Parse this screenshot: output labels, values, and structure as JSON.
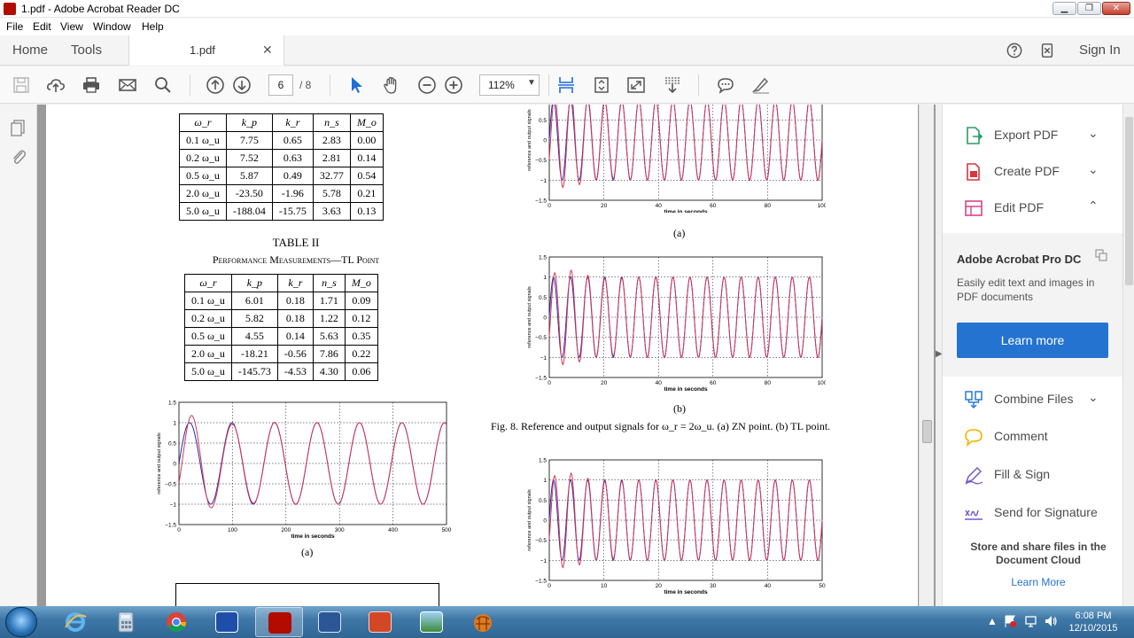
{
  "window": {
    "title": "1.pdf - Adobe Acrobat Reader DC",
    "minimize": "▁",
    "maximize": "❐",
    "close": "✕"
  },
  "menu": [
    "File",
    "Edit",
    "View",
    "Window",
    "Help"
  ],
  "tabs": {
    "home": "Home",
    "tools": "Tools",
    "document": "1.pdf",
    "close_glyph": "✕",
    "sign_in": "Sign In"
  },
  "toolbar": {
    "page_current": "6",
    "page_total": "/ 8",
    "zoom": "112%",
    "zoom_caret": "▼"
  },
  "document": {
    "table1": {
      "headers": [
        "ω_r",
        "k_p",
        "k_r",
        "n_s",
        "M_o"
      ],
      "rows": [
        [
          "0.1 ω_u",
          "7.75",
          "0.65",
          "2.83",
          "0.00"
        ],
        [
          "0.2 ω_u",
          "7.52",
          "0.63",
          "2.81",
          "0.14"
        ],
        [
          "0.5 ω_u",
          "5.87",
          "0.49",
          "32.77",
          "0.54"
        ],
        [
          "2.0 ω_u",
          "-23.50",
          "-1.96",
          "5.78",
          "0.21"
        ],
        [
          "5.0 ω_u",
          "-188.04",
          "-15.75",
          "3.63",
          "0.13"
        ]
      ]
    },
    "table2_title": "TABLE II",
    "table2_subtitle": "Performance Measurements—TL Point",
    "table2": {
      "headers": [
        "ω_r",
        "k_p",
        "k_r",
        "n_s",
        "M_o"
      ],
      "rows": [
        [
          "0.1 ω_u",
          "6.01",
          "0.18",
          "1.71",
          "0.09"
        ],
        [
          "0.2 ω_u",
          "5.82",
          "0.18",
          "1.22",
          "0.12"
        ],
        [
          "0.5 ω_u",
          "4.55",
          "0.14",
          "5.63",
          "0.35"
        ],
        [
          "2.0 ω_u",
          "-18.21",
          "-0.56",
          "7.86",
          "0.22"
        ],
        [
          "5.0 ω_u",
          "-145.73",
          "-4.53",
          "4.30",
          "0.06"
        ]
      ]
    },
    "fig8_caption": "Fig. 8.    Reference and output signals for ω_r = 2ω_u. (a) ZN point. (b) TL point.",
    "plot_ylabel": "reference and output signals",
    "plot_xlabel": "time in seconds",
    "yticks": [
      "1.5",
      "1",
      "0.5",
      "0",
      "−0.5",
      "−1",
      "−1.5"
    ]
  },
  "chart_data": [
    {
      "type": "line",
      "panel": "(a)",
      "xlabel": "time in seconds",
      "ylabel": "reference and output signals",
      "xlim": [
        0,
        100
      ],
      "ylim": [
        -1.5,
        1.5
      ],
      "xticks": [
        "0",
        "20",
        "40",
        "60",
        "80",
        "100"
      ],
      "series": [
        {
          "color": "#2a2aa6",
          "cycles": 16
        },
        {
          "color": "#d23a5a",
          "cycles": 16
        }
      ]
    },
    {
      "type": "line",
      "panel": "(b)",
      "xlabel": "time in seconds",
      "ylabel": "reference and output signals",
      "xlim": [
        0,
        100
      ],
      "ylim": [
        -1.5,
        1.5
      ],
      "xticks": [
        "0",
        "20",
        "40",
        "60",
        "80",
        "100"
      ],
      "series": [
        {
          "color": "#2a2aa6",
          "cycles": 16
        },
        {
          "color": "#d23a5a",
          "cycles": 16
        }
      ]
    },
    {
      "type": "line",
      "panel": "(a)",
      "xlabel": "time in seconds",
      "ylabel": "reference and output signals",
      "xlim": [
        0,
        500
      ],
      "ylim": [
        -1.5,
        1.5
      ],
      "xticks": [
        "0",
        "100",
        "200",
        "300",
        "400",
        "500"
      ],
      "series": [
        {
          "color": "#2a2aa6",
          "cycles": 6.3
        },
        {
          "color": "#d23a5a",
          "cycles": 6.3
        }
      ]
    },
    {
      "type": "line",
      "xlabel": "time in seconds",
      "ylabel": "reference and output signals",
      "xlim": [
        0,
        50
      ],
      "ylim": [
        -1.5,
        1.5
      ],
      "xticks": [
        "0",
        "10",
        "20",
        "30",
        "40",
        "50"
      ],
      "series": [
        {
          "color": "#2a2aa6",
          "cycles": 16
        },
        {
          "color": "#d23a5a",
          "cycles": 16
        }
      ]
    }
  ],
  "right_panel": {
    "tools": [
      {
        "label": "Export PDF",
        "chev": "⌄",
        "color": "#2e9a64"
      },
      {
        "label": "Create PDF",
        "chev": "⌄",
        "color": "#d7373f"
      },
      {
        "label": "Edit PDF",
        "chev": "⌃",
        "color": "#d6448a"
      }
    ],
    "promo_title": "Adobe Acrobat Pro DC",
    "promo_desc": "Easily edit text and images in PDF documents",
    "promo_button": "Learn more",
    "tools2": [
      {
        "label": "Combine Files",
        "chev": "⌄",
        "color": "#2a7ad6"
      },
      {
        "label": "Comment",
        "chev": "",
        "color": "#f0b400"
      },
      {
        "label": "Fill & Sign",
        "chev": "",
        "color": "#6d5bd0"
      },
      {
        "label": "Send for Signature",
        "chev": "",
        "color": "#6d5bd0"
      }
    ],
    "store_text": "Store and share files in the Document Cloud",
    "learn_more": "Learn More"
  },
  "taskbar": {
    "time": "6:08 PM",
    "date": "12/10/2015",
    "tray_up": "▲"
  }
}
